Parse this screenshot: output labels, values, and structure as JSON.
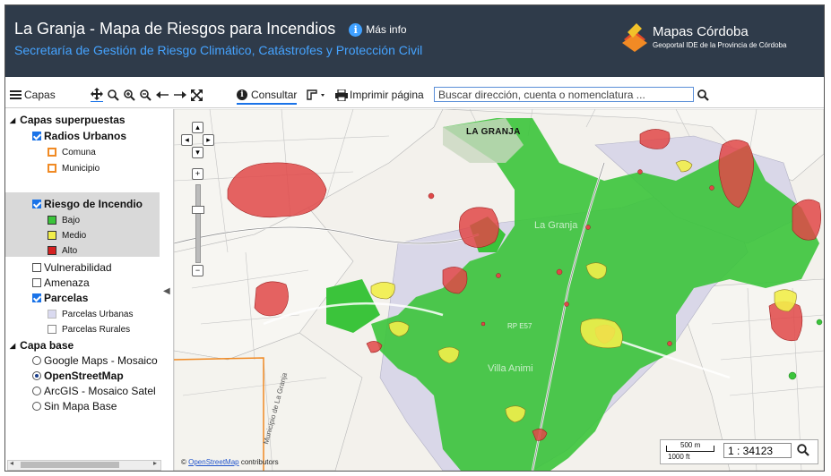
{
  "header": {
    "title": "La Granja - Mapa de Riesgos para Incendios",
    "info_label": "Más info",
    "subtitle": "Secretaría de Gestión de Riesgo Climático, Catástrofes y Protección Civil",
    "brand_name": "Mapas Córdoba",
    "brand_sub": "Geoportal IDE de la Provincia de Córdoba"
  },
  "toolbar": {
    "layers_label": "Capas",
    "query_label": "Consultar",
    "print_label": "Imprimir página",
    "search_placeholder": "Buscar dirección, cuenta o nomenclatura ..."
  },
  "sidebar": {
    "overlay_title": "Capas superpuestas",
    "radios_label": "Radios Urbanos",
    "comuna_label": "Comuna",
    "municipio_label": "Municipio",
    "riesgo_label": "Riesgo de Incendio",
    "bajo_label": "Bajo",
    "medio_label": "Medio",
    "alto_label": "Alto",
    "vulnerabilidad_label": "Vulnerabilidad",
    "amenaza_label": "Amenaza",
    "parcelas_label": "Parcelas",
    "parcelas_urbanas_label": "Parcelas Urbanas",
    "parcelas_rurales_label": "Parcelas Rurales",
    "base_title": "Capa base",
    "base_google": "Google Maps - Mosaico",
    "base_osm": "OpenStreetMap",
    "base_arcgis": "ArcGIS - Mosaico Satel",
    "base_none": "Sin Mapa Base"
  },
  "map": {
    "town_label": "LA GRANJA",
    "place_la_granja": "La Granja",
    "place_villa_animi": "Villa Animi",
    "road_label": "Municipio de La Granja",
    "rp_label": "RP E57",
    "scale_m": "500 m",
    "scale_ft": "1000 ft",
    "scale_value": "1 : 34123",
    "attribution_link": "OpenStreetMap",
    "attribution_rest": "contributors"
  },
  "colors": {
    "header_bg": "#2f3b4a",
    "subtitle": "#45a3ff",
    "risk_low": "#3bc43b",
    "risk_medium": "#f2ee4a",
    "risk_high": "#e04848",
    "comuna": "#f08a24",
    "municipio": "#f08a24"
  },
  "icons": [
    "info-icon",
    "hamburger-icon",
    "pan-icon",
    "zoom-icon",
    "zoom-in-icon",
    "zoom-out-icon",
    "back-arrow-icon",
    "forward-arrow-icon",
    "full-extent-icon",
    "print-icon",
    "search-icon"
  ]
}
